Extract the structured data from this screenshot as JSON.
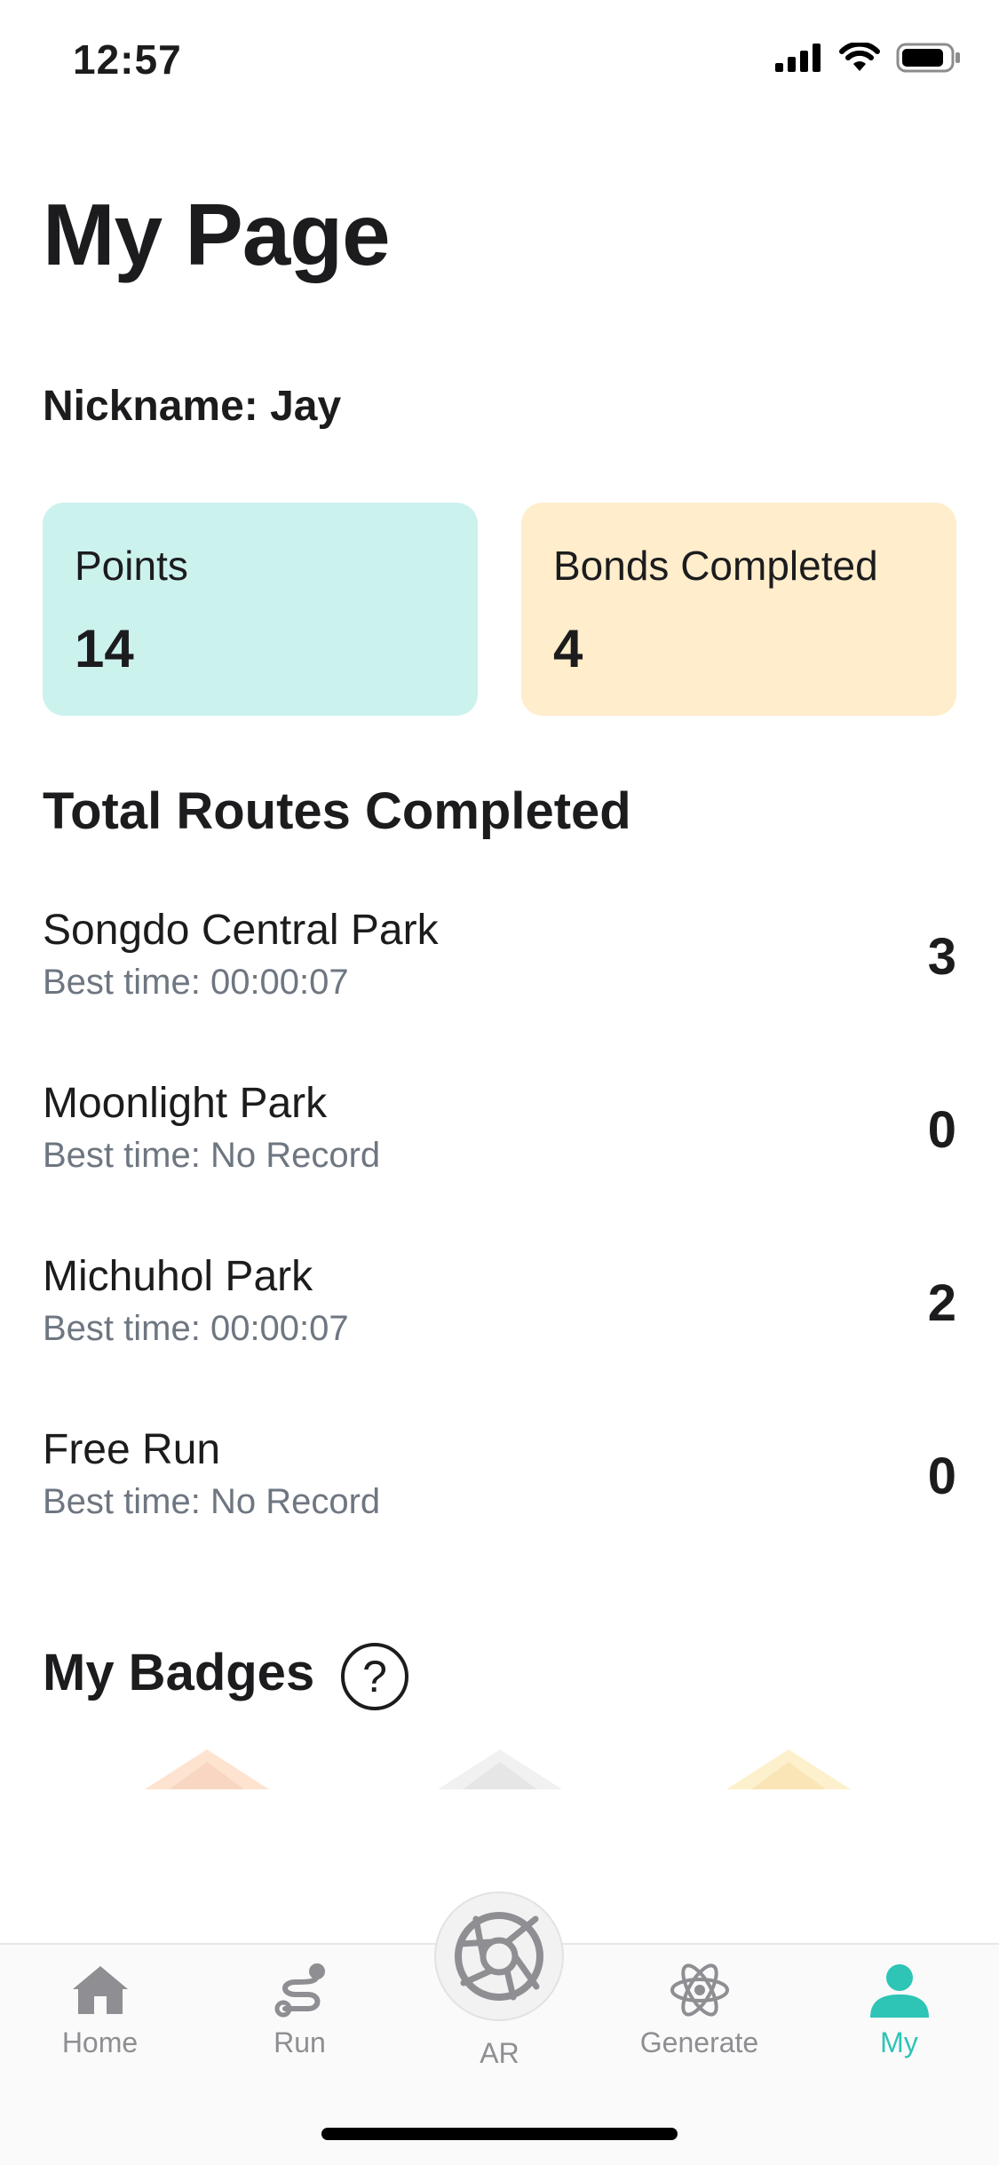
{
  "status_bar": {
    "time": "12:57"
  },
  "header": {
    "title": "My Page"
  },
  "profile": {
    "nickname": "Nickname: Jay"
  },
  "stats": {
    "points": {
      "label": "Points",
      "value": "14",
      "color": "#ccf2ee"
    },
    "bonds": {
      "label": "Bonds Completed",
      "value": "4",
      "color": "#ffedcc"
    }
  },
  "routes": {
    "title": "Total Routes Completed",
    "items": [
      {
        "name": "Songdo Central Park",
        "best": "Best time: 00:00:07",
        "count": "3"
      },
      {
        "name": "Moonlight Park",
        "best": "Best time: No Record",
        "count": "0"
      },
      {
        "name": "Michuhol Park",
        "best": "Best time: 00:00:07",
        "count": "2"
      },
      {
        "name": "Free Run",
        "best": "Best time: No Record",
        "count": "0"
      }
    ]
  },
  "badges": {
    "title": "My Badges",
    "help_symbol": "?"
  },
  "tab_bar": {
    "accent": "#2ec4b6",
    "tabs": [
      {
        "label": "Home",
        "icon": "home-icon"
      },
      {
        "label": "Run",
        "icon": "route-icon"
      },
      {
        "label": "AR",
        "icon": "camera-aperture-icon"
      },
      {
        "label": "Generate",
        "icon": "atom-icon"
      },
      {
        "label": "My",
        "icon": "person-icon",
        "active": true
      }
    ]
  }
}
